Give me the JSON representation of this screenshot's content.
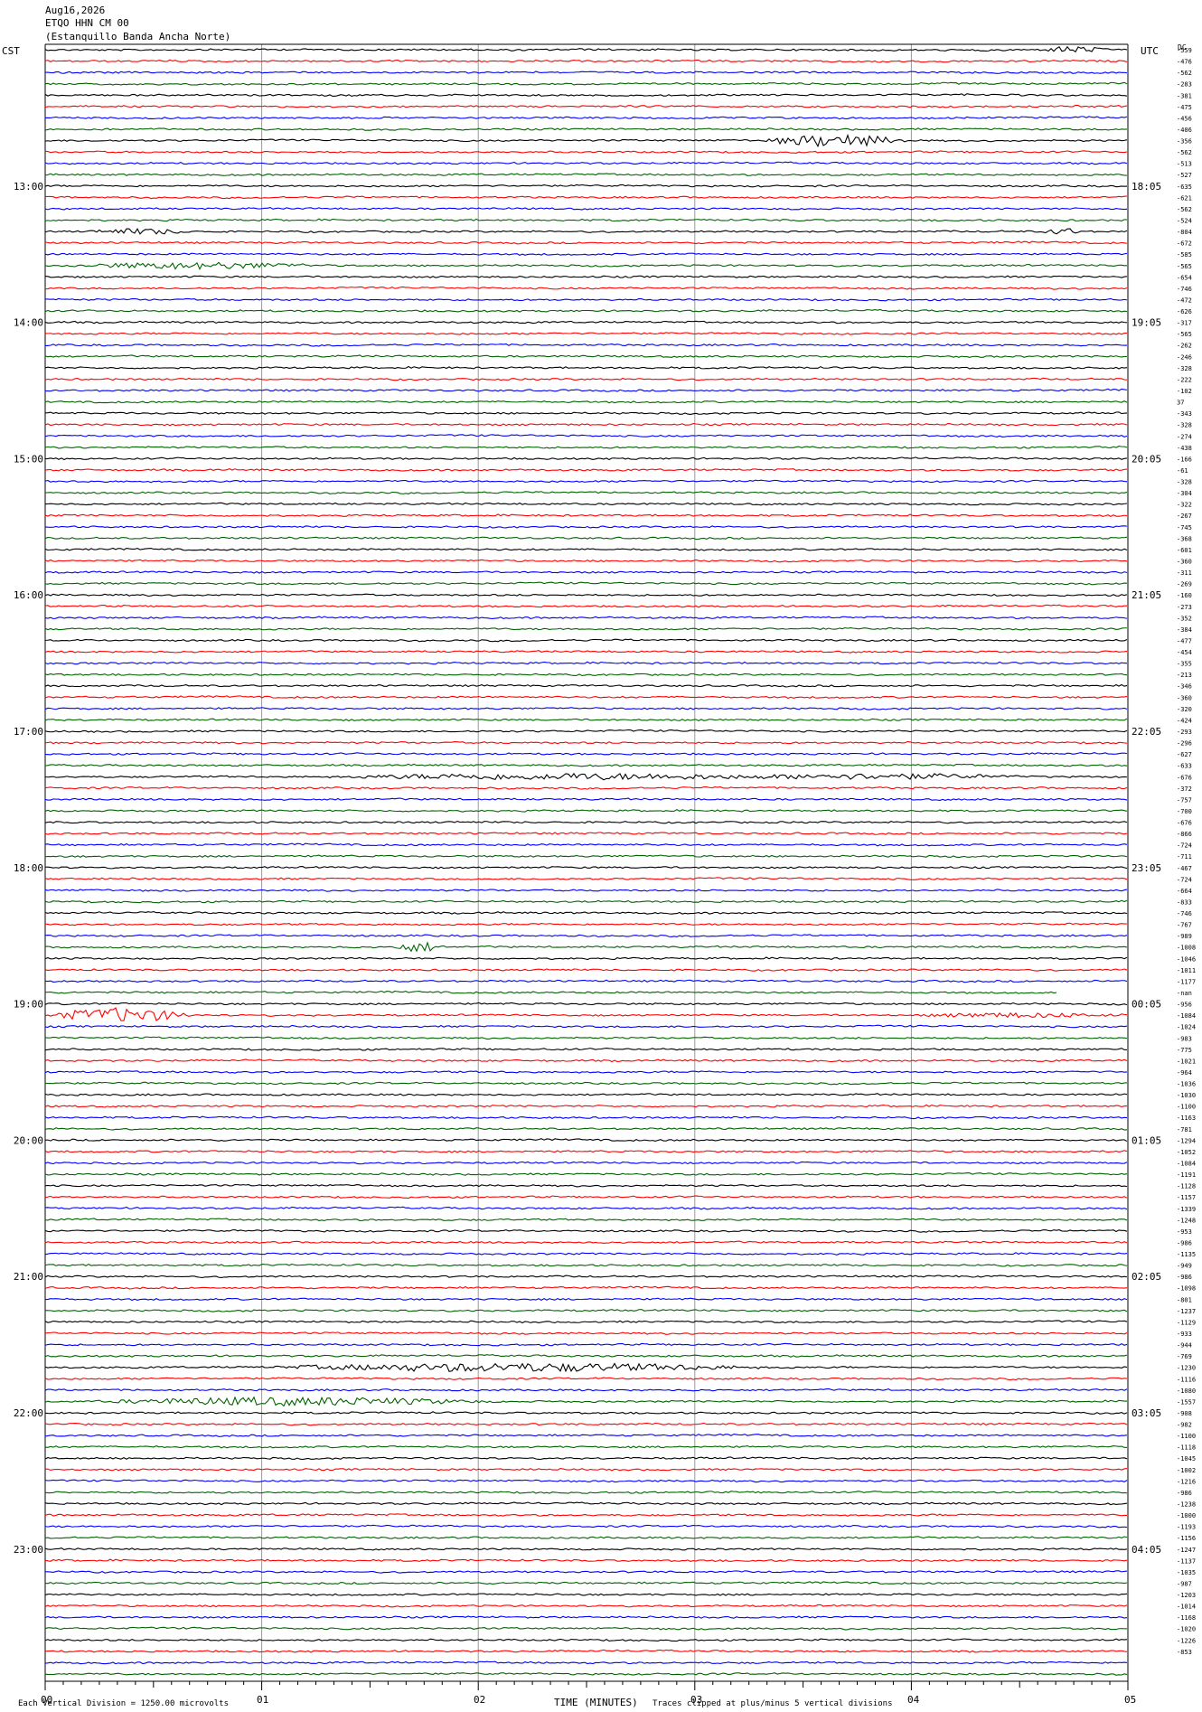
{
  "header": {
    "date": "Aug16,2026",
    "channel": "ETQO HHN CM 00",
    "station": "(Estanquillo Banda Ancha Norte)"
  },
  "labels": {
    "left_tz": "CST",
    "right_tz": "UTC",
    "right_corner": "DC"
  },
  "footer": {
    "scale_note": "Each Vertical Division = 1250.00 microvolts",
    "x_axis_title": "TIME (MINUTES)",
    "clip_note": "Traces clipped at plus/minus 5 vertical divisions"
  },
  "colors": {
    "cycle": [
      "#000000",
      "#ff0000",
      "#0000ff",
      "#006400"
    ],
    "grid": "#999999"
  },
  "chart_data": {
    "type": "line",
    "xlabel": "TIME (MINUTES)",
    "x_ticks": [
      "00",
      "01",
      "02",
      "03",
      "04",
      "05"
    ],
    "xlim": [
      0,
      5
    ],
    "trace_count": 144,
    "left_hour_labels": [
      {
        "row": 12,
        "label": "13:00"
      },
      {
        "row": 24,
        "label": "14:00"
      },
      {
        "row": 36,
        "label": "15:00"
      },
      {
        "row": 48,
        "label": "16:00"
      },
      {
        "row": 60,
        "label": "17:00"
      },
      {
        "row": 72,
        "label": "18:00"
      },
      {
        "row": 84,
        "label": "19:00"
      },
      {
        "row": 96,
        "label": "20:00"
      },
      {
        "row": 108,
        "label": "21:00"
      },
      {
        "row": 120,
        "label": "22:00"
      },
      {
        "row": 132,
        "label": "23:00"
      }
    ],
    "right_hour_labels": [
      {
        "row": 12,
        "label": "18:05"
      },
      {
        "row": 24,
        "label": "19:05"
      },
      {
        "row": 36,
        "label": "20:05"
      },
      {
        "row": 48,
        "label": "21:05"
      },
      {
        "row": 60,
        "label": "22:05"
      },
      {
        "row": 72,
        "label": "23:05"
      },
      {
        "row": 84,
        "label": "00:05"
      },
      {
        "row": 96,
        "label": "01:05"
      },
      {
        "row": 108,
        "label": "02:05"
      },
      {
        "row": 120,
        "label": "03:05"
      },
      {
        "row": 132,
        "label": "04:05"
      }
    ],
    "offsets": [
      "-559",
      "-476",
      "-562",
      "-283",
      "-381",
      "-475",
      "-456",
      "-406",
      "-356",
      "-562",
      "-513",
      "-527",
      "-635",
      "-621",
      "-562",
      "-524",
      "-804",
      "-672",
      "-585",
      "-565",
      "-654",
      "-746",
      "-472",
      "-626",
      "-317",
      "-565",
      "-262",
      "-246",
      "-328",
      "-222",
      "-102",
      "37",
      "-343",
      "-328",
      "-274",
      "-438",
      "-166",
      "-61",
      "-328",
      "-304",
      "-322",
      "-267",
      "-745",
      "-368",
      "-601",
      "-360",
      "-311",
      "-269",
      "-160",
      "-273",
      "-352",
      "-384",
      "-477",
      "-454",
      "-355",
      "-213",
      "-346",
      "-360",
      "-320",
      "-424",
      "-293",
      "-296",
      "-627",
      "-633",
      "-676",
      "-372",
      "-757",
      "-700",
      "-676",
      "-866",
      "-724",
      "-711",
      "-467",
      "-724",
      "-664",
      "-833",
      "-746",
      "-767",
      "-989",
      "-1008",
      "-1046",
      "-1011",
      "-1177",
      "-nan",
      "-956",
      "-1084",
      "-1024",
      "-983",
      "-775",
      "-1021",
      "-964",
      "-1036",
      "-1030",
      "-1100",
      "-1163",
      "-781",
      "-1294",
      "-1052",
      "-1084",
      "-1191",
      "-1128",
      "-1157",
      "-1339",
      "-1248",
      "-953",
      "-986",
      "-1135",
      "-949",
      "-986",
      "-1098",
      "-801",
      "-1237",
      "-1129",
      "-933",
      "-944",
      "-769",
      "-1230",
      "-1116",
      "-1080",
      "-1557",
      "-908",
      "-982",
      "-1100",
      "-1118",
      "-1045",
      "-1002",
      "-1216",
      "-986",
      "-1238",
      "-1000",
      "-1193",
      "-1156",
      "-1247",
      "-1137",
      "-1035",
      "-987",
      "-1203",
      "-1014",
      "-1168",
      "-1020",
      "-1226",
      "-853"
    ]
  }
}
